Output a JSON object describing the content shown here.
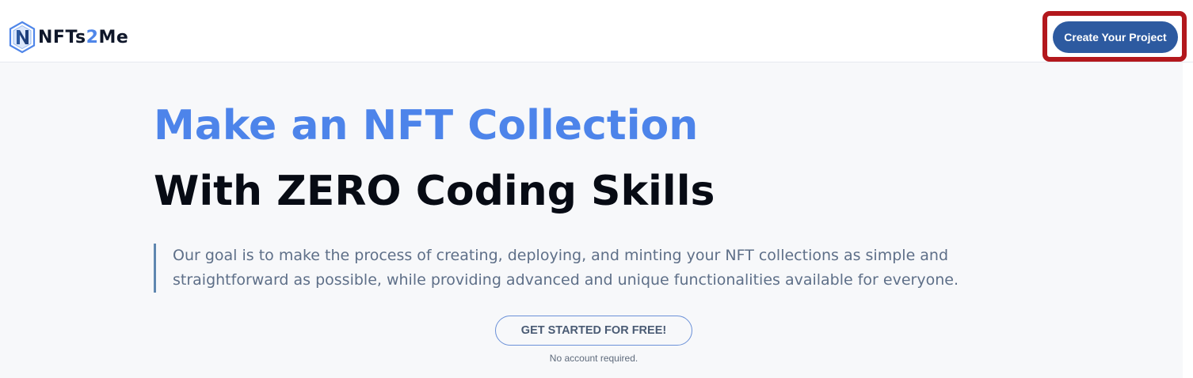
{
  "header": {
    "logo": {
      "prefix": "NFTs",
      "highlight": "2",
      "suffix": "Me",
      "icon": "nfts2me-logo-icon"
    },
    "create_project_label": "Create Your Project",
    "highlight_color": "#b3181d"
  },
  "hero": {
    "headline_primary": "Make an NFT Collection",
    "headline_secondary": "With ZERO Coding Skills",
    "description": "Our goal is to make the process of creating, deploying, and minting your NFT collections as simple and straightforward as possible, while providing advanced and unique functionalities available for everyone.",
    "cta_label": "GET STARTED FOR FREE!",
    "cta_note": "No account required."
  },
  "colors": {
    "accent_blue": "#4d84ea",
    "button_blue": "#2d5aa0",
    "background": "#f7f8fa"
  }
}
